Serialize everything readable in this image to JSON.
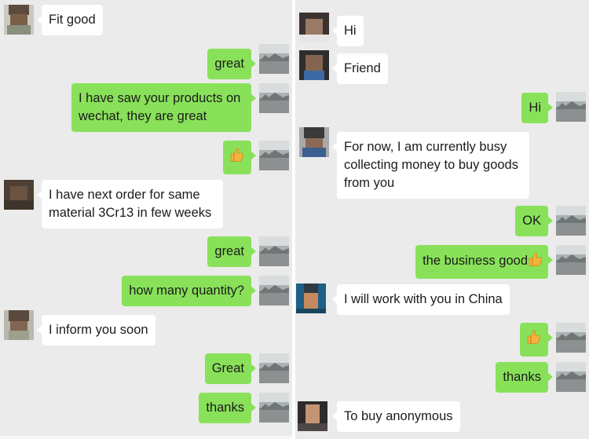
{
  "left_chat": {
    "messages": [
      {
        "side": "other",
        "text": "Fit good"
      },
      {
        "side": "me",
        "text": "great"
      },
      {
        "side": "me",
        "text": "I have saw your products on wechat, they are great"
      },
      {
        "side": "me",
        "icon": "thumbs-up-icon"
      },
      {
        "side": "other",
        "text": "I have next order for same material 3Cr13 in few weeks"
      },
      {
        "side": "me",
        "text": "great"
      },
      {
        "side": "me",
        "text": "how many quantity?"
      },
      {
        "side": "other",
        "text": "I inform you soon"
      },
      {
        "side": "me",
        "text": "Great"
      },
      {
        "side": "me",
        "text": "thanks"
      }
    ]
  },
  "right_chat": {
    "messages": [
      {
        "side": "other",
        "text": "Hi"
      },
      {
        "side": "other",
        "text": "Friend"
      },
      {
        "side": "me",
        "text": "Hi"
      },
      {
        "side": "other",
        "text": "For now, I am currently busy collecting money to buy goods from you"
      },
      {
        "side": "me",
        "text": "OK"
      },
      {
        "side": "me",
        "text": "the business good",
        "icon": "thumbs-up-icon"
      },
      {
        "side": "other",
        "text": "I will work with you in China"
      },
      {
        "side": "me",
        "icon": "thumbs-up-icon"
      },
      {
        "side": "me",
        "text": "thanks"
      },
      {
        "side": "other",
        "text": "To buy anonymous"
      }
    ]
  },
  "colors": {
    "background": "#ebebeb",
    "my_bubble": "#89e15a",
    "their_bubble": "#ffffff",
    "thumbs_up": "#f3b33d"
  }
}
